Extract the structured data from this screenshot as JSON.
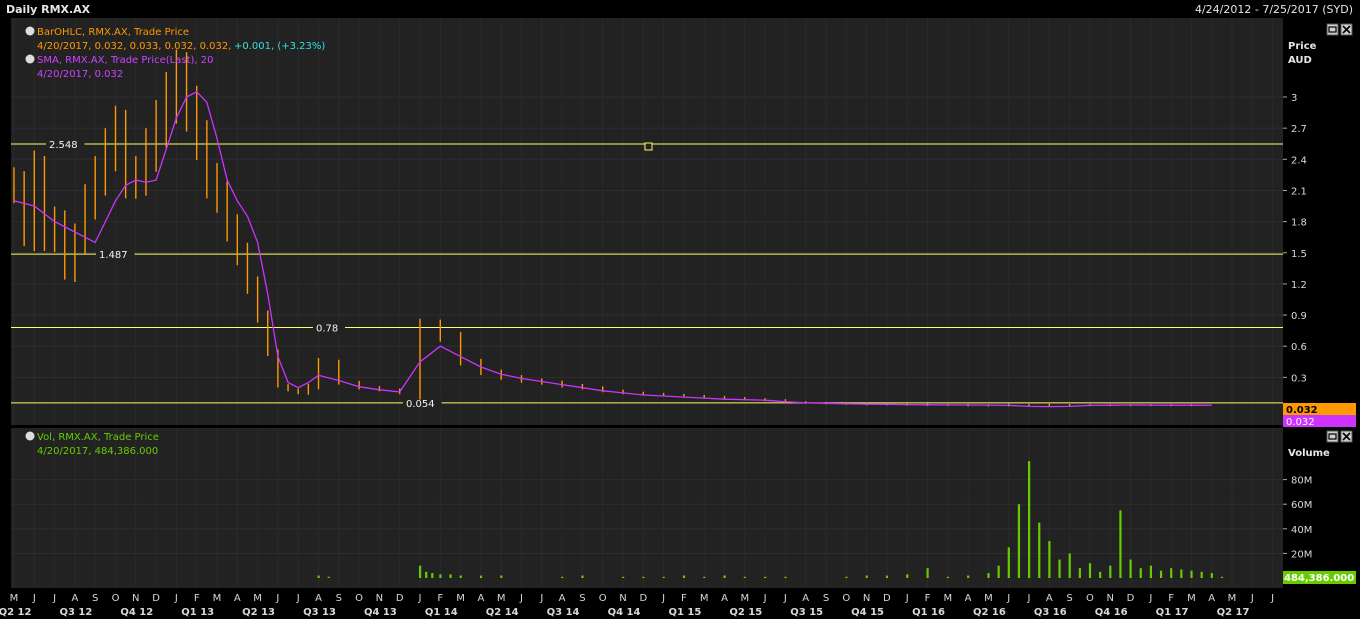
{
  "window": {
    "title": "Daily RMX.AX",
    "date_range": "4/24/2012 - 7/25/2017 (SYD)"
  },
  "price_panel": {
    "legend_ohlc_title": "BarOHLC, RMX.AX, Trade Price",
    "legend_ohlc_values": "4/20/2017, 0.032, 0.033, 0.032, 0.032,",
    "legend_ohlc_change": "+0.001, (+3.23%)",
    "legend_sma_title": "SMA, RMX.AX, Trade Price(Last),  20",
    "legend_sma_values": "4/20/2017, 0.032",
    "axis_title_1": "Price",
    "axis_title_2": "AUD",
    "last_price_badge": "0.032",
    "sma_badge": "0.032",
    "ohlc_color": "#ff9900",
    "sma_color": "#cc33ff",
    "hline_color": "#ffff66"
  },
  "volume_panel": {
    "legend_title": "Vol, RMX.AX, Trade Price",
    "legend_values": "4/20/2017, 484,386.000",
    "axis_title": "Volume",
    "last_volume_badge": "484,386.000",
    "volume_color": "#66cc00"
  },
  "panel_icons": [
    "restore-icon",
    "close-icon"
  ],
  "chart_data": [
    {
      "type": "line",
      "title": "Daily RMX.AX",
      "ylabel": "Price AUD",
      "ylim": [
        0.0,
        3.2
      ],
      "yticks": [
        0.3,
        0.6,
        0.9,
        1.2,
        1.5,
        1.8,
        2.1,
        2.4,
        2.7,
        3
      ],
      "ytick_labels": [
        "0.3",
        "0.6",
        "0.9",
        "1.2",
        "1.5",
        "1.8",
        "2.1",
        "2.4",
        "2.7",
        "3"
      ],
      "horizontal_lines": [
        {
          "value": 2.548,
          "label": "2.548"
        },
        {
          "value": 1.487,
          "label": "1.487"
        },
        {
          "value": 0.78,
          "label": "0.78"
        },
        {
          "value": 0.054,
          "label": "0.054"
        }
      ],
      "x_months": [
        "M",
        "J",
        "J",
        "A",
        "S",
        "O",
        "N",
        "D",
        "J",
        "F",
        "M",
        "A",
        "M",
        "J",
        "J",
        "A",
        "S",
        "O",
        "N",
        "D",
        "J",
        "F",
        "M",
        "A",
        "M",
        "J",
        "J",
        "A",
        "S",
        "O",
        "N",
        "D",
        "J",
        "F",
        "M",
        "A",
        "M",
        "J",
        "J",
        "A",
        "S",
        "O",
        "N",
        "D",
        "J",
        "F",
        "M",
        "A",
        "M",
        "J",
        "J",
        "A",
        "S",
        "O",
        "N",
        "D",
        "J",
        "F",
        "M",
        "A",
        "M",
        "J",
        "J"
      ],
      "x_quarters": [
        "Q2 12",
        "Q3 12",
        "Q4 12",
        "Q1 13",
        "Q2 13",
        "Q3 13",
        "Q4 13",
        "Q1 14",
        "Q2 14",
        "Q3 14",
        "Q4 14",
        "Q1 15",
        "Q2 15",
        "Q3 15",
        "Q4 15",
        "Q1 16",
        "Q2 16",
        "Q3 16",
        "Q4 16",
        "Q1 17",
        "Q2 17"
      ],
      "series": [
        {
          "name": "BarOHLC, RMX.AX, Trade Price",
          "style": "ohlc",
          "x_month_index": [
            0,
            0.5,
            1,
            1.5,
            2,
            2.5,
            3,
            3.5,
            4,
            4.5,
            5,
            5.5,
            6,
            6.5,
            7,
            7.5,
            8,
            8.5,
            9,
            9.5,
            10,
            10.5,
            11,
            11.5,
            12,
            12.5,
            13,
            13.5,
            14,
            14.5,
            15,
            16,
            17,
            18,
            19,
            20,
            21,
            22,
            23,
            24,
            25,
            26,
            27,
            28,
            29,
            30,
            31,
            32,
            33,
            34,
            35,
            36,
            37,
            38,
            39,
            40,
            41,
            42,
            43,
            44,
            45,
            46,
            47,
            48,
            49,
            50,
            51,
            52,
            53,
            54,
            55,
            56,
            57,
            58,
            59,
            59.5
          ],
          "values": [
            2.15,
            1.7,
            2.3,
            1.65,
            1.8,
            1.35,
            1.65,
            2.0,
            2.25,
            2.5,
            2.7,
            2.2,
            2.25,
            2.5,
            2.75,
            3.0,
            3.2,
            2.9,
            2.6,
            2.2,
            2.05,
            1.75,
            1.5,
            1.2,
            0.9,
            0.55,
            0.22,
            0.18,
            0.15,
            0.22,
            0.45,
            0.25,
            0.2,
            0.18,
            0.15,
            0.8,
            0.7,
            0.45,
            0.35,
            0.3,
            0.27,
            0.25,
            0.22,
            0.2,
            0.17,
            0.15,
            0.14,
            0.13,
            0.12,
            0.11,
            0.1,
            0.09,
            0.08,
            0.06,
            0.055,
            0.05,
            0.045,
            0.04,
            0.04,
            0.038,
            0.035,
            0.035,
            0.03,
            0.03,
            0.035,
            0.035,
            0.032,
            0.032,
            0.032,
            0.032,
            0.032,
            0.032,
            0.032,
            0.032
          ]
        },
        {
          "name": "SMA, RMX.AX, Trade Price(Last),  20",
          "style": "line",
          "x_month_index": [
            0,
            1,
            2,
            3,
            4,
            4.5,
            5,
            5.5,
            6,
            6.5,
            7,
            7.5,
            8,
            8.5,
            9,
            9.5,
            10,
            10.5,
            11,
            11.5,
            12,
            12.5,
            13,
            13.5,
            14,
            14.5,
            15,
            16,
            17,
            18,
            19,
            20,
            21,
            22,
            23,
            24,
            25,
            26,
            27,
            28,
            29,
            30,
            31,
            32,
            33,
            34,
            35,
            36,
            37,
            38,
            39,
            40,
            41,
            42,
            43,
            44,
            45,
            46,
            47,
            48,
            49,
            50,
            51,
            52,
            53,
            54,
            55,
            56,
            57,
            58,
            59
          ],
          "values": [
            2.0,
            1.95,
            1.8,
            1.7,
            1.6,
            1.8,
            2.0,
            2.15,
            2.2,
            2.18,
            2.2,
            2.5,
            2.8,
            3.0,
            3.05,
            2.95,
            2.6,
            2.2,
            2.0,
            1.85,
            1.6,
            1.1,
            0.5,
            0.25,
            0.2,
            0.25,
            0.32,
            0.27,
            0.21,
            0.18,
            0.16,
            0.45,
            0.6,
            0.5,
            0.4,
            0.33,
            0.29,
            0.26,
            0.23,
            0.2,
            0.17,
            0.15,
            0.13,
            0.12,
            0.11,
            0.1,
            0.09,
            0.085,
            0.08,
            0.065,
            0.055,
            0.05,
            0.045,
            0.042,
            0.04,
            0.038,
            0.036,
            0.035,
            0.034,
            0.033,
            0.03,
            0.02,
            0.018,
            0.02,
            0.03,
            0.032,
            0.034,
            0.033,
            0.032,
            0.032,
            0.032
          ]
        }
      ]
    },
    {
      "type": "bar",
      "title": "Vol, RMX.AX, Trade Price",
      "ylabel": "Volume",
      "ylim": [
        0,
        100
      ],
      "yticks": [
        20,
        40,
        60,
        80
      ],
      "ytick_labels": [
        "20M",
        "40M",
        "60M",
        "80M"
      ],
      "series": [
        {
          "name": "Vol, RMX.AX, Trade Price",
          "unit": "M",
          "x_month_index": [
            15,
            15.5,
            20,
            20.3,
            20.6,
            21,
            21.5,
            22,
            23,
            24,
            27,
            28,
            30,
            31,
            32,
            33,
            34,
            35,
            36,
            37,
            38,
            41,
            42,
            43,
            44,
            45,
            46,
            47,
            48,
            48.5,
            49,
            49.5,
            50,
            50.5,
            51,
            51.5,
            52,
            52.5,
            53,
            53.5,
            54,
            54.5,
            55,
            55.5,
            56,
            56.5,
            57,
            57.5,
            58,
            58.5,
            59,
            59.5
          ],
          "values": [
            2,
            1,
            10,
            5,
            4,
            3,
            3,
            2,
            2,
            2,
            1,
            2,
            1,
            1,
            1,
            2,
            1,
            2,
            1,
            1,
            1,
            1,
            2,
            2,
            3,
            8,
            1,
            2,
            4,
            10,
            25,
            60,
            95,
            45,
            30,
            15,
            20,
            8,
            12,
            5,
            10,
            55,
            15,
            8,
            10,
            6,
            8,
            7,
            6,
            5,
            4,
            1
          ]
        }
      ]
    }
  ]
}
